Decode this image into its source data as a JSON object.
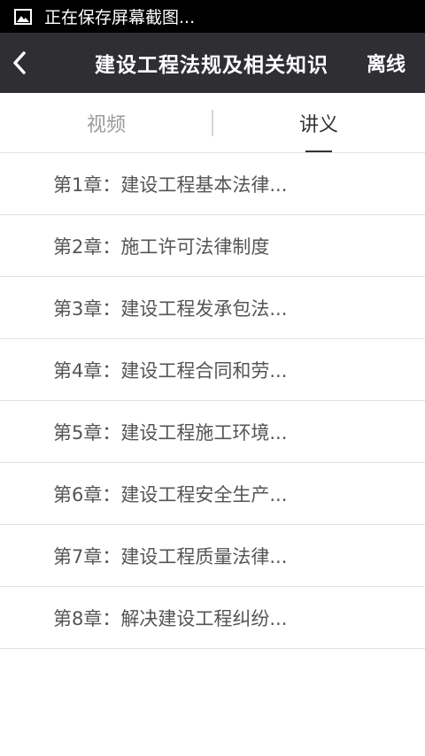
{
  "status_bar": {
    "notification_icon": "image-icon",
    "text": "正在保存屏幕截图..."
  },
  "nav": {
    "back_icon": "chevron-left-icon",
    "title": "建设工程法规及相关知识",
    "offline_label": "离线"
  },
  "tabs": [
    {
      "label": "视频",
      "active": false
    },
    {
      "label": "讲义",
      "active": true
    }
  ],
  "chapters": [
    {
      "label": "第1章：建设工程基本法律..."
    },
    {
      "label": "第2章：施工许可法律制度"
    },
    {
      "label": "第3章：建设工程发承包法..."
    },
    {
      "label": "第4章：建设工程合同和劳..."
    },
    {
      "label": "第5章：建设工程施工环境..."
    },
    {
      "label": "第6章：建设工程安全生产..."
    },
    {
      "label": "第7章：建设工程质量法律..."
    },
    {
      "label": "第8章：解决建设工程纠纷..."
    }
  ],
  "colors": {
    "status_bar_bg": "#000000",
    "nav_bg": "#2f2f33",
    "tab_inactive": "#9a9a9a",
    "tab_active": "#333333",
    "list_text": "#555555",
    "divider": "#e2e2e2"
  }
}
